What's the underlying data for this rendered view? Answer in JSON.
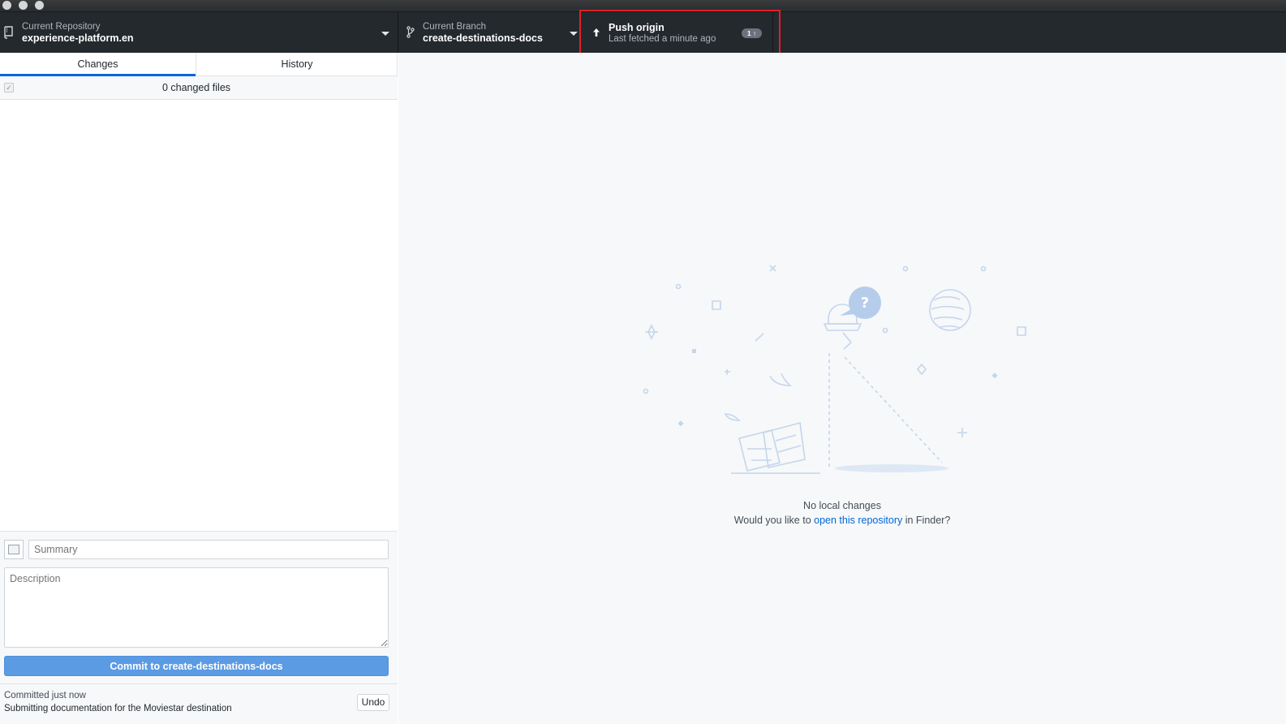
{
  "window": {
    "traffic_lights": [
      "close",
      "minimize",
      "zoom"
    ]
  },
  "toolbar": {
    "repository": {
      "label": "Current Repository",
      "value": "experience-platform.en",
      "icon": "repo-icon"
    },
    "branch": {
      "label": "Current Branch",
      "value": "create-destinations-docs",
      "icon": "git-branch-icon"
    },
    "push": {
      "title": "Push origin",
      "subtitle": "Last fetched a minute ago",
      "badge": "1 ↑",
      "icon": "arrow-up-icon"
    },
    "highlight_color": "#e0202a"
  },
  "tabs": {
    "changes": "Changes",
    "history": "History",
    "active": "Changes"
  },
  "changes": {
    "count_text": "0 changed files"
  },
  "commit": {
    "summary_placeholder": "Summary",
    "description_placeholder": "Description",
    "button_label": "Commit to create-destinations-docs"
  },
  "undo": {
    "status": "Committed just now",
    "message": "Submitting documentation for the Moviestar destination",
    "button_label": "Undo"
  },
  "blank_slate": {
    "title": "No local changes",
    "text_before": "Would you like to ",
    "link_text": "open this repository",
    "text_after": " in Finder?"
  },
  "colors": {
    "accent": "#0366d6",
    "commit_button": "#5b9be4",
    "toolbar_bg": "#24292e"
  }
}
